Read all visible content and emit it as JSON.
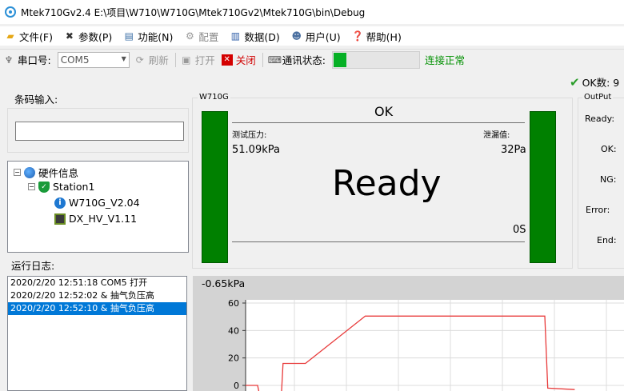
{
  "window": {
    "title": "Mtek710Gv2.4 E:\\项目\\W710\\W710G\\Mtek710Gv2\\Mtek710G\\bin\\Debug"
  },
  "menu": [
    {
      "label": "文件(F)",
      "icon": "folder-icon"
    },
    {
      "label": "参数(P)",
      "icon": "tools-icon"
    },
    {
      "label": "功能(N)",
      "icon": "document-icon"
    },
    {
      "label": "配置",
      "icon": "gear-icon"
    },
    {
      "label": "数据(D)",
      "icon": "chart-icon"
    },
    {
      "label": "用户(U)",
      "icon": "users-icon"
    },
    {
      "label": "帮助(H)",
      "icon": "help-icon"
    }
  ],
  "toolbar": {
    "port_label": "串口号:",
    "port_value": "COM5",
    "refresh_label": "刷新",
    "open_label": "打开",
    "close_label": "关闭",
    "comm_status_label": "通讯状态:",
    "comm_level": 0.15,
    "connection_text": "连接正常"
  },
  "ok_count_label": "OK数: 9",
  "barcode": {
    "label": "条码输入:",
    "value": ""
  },
  "tree": {
    "root": "硬件信息",
    "station": "Station1",
    "items": [
      "W710G_V2.04",
      "DX_HV_V1.11"
    ]
  },
  "w710g": {
    "group_title": "W710G",
    "result": "OK",
    "pressure_label": "测试压力:",
    "pressure_value": "51.09kPa",
    "leak_label": "泄漏值:",
    "leak_value": "32Pa",
    "status": "Ready",
    "time_value": "0S"
  },
  "output": {
    "group_title": "OutPut",
    "labels": [
      "Ready:",
      "OK:",
      "NG:",
      "Error:",
      "End:"
    ]
  },
  "log": {
    "label": "运行日志:",
    "entries": [
      "2020/2/20 12:51:18 COM5 打开",
      "2020/2/20 12:52:02 & 抽气负压高",
      "2020/2/20 12:52:10 & 抽气负压高"
    ],
    "selected_index": 2
  },
  "chart_data": {
    "type": "line",
    "title": "-0.65kPa",
    "yticks": [
      0,
      20,
      40,
      60
    ],
    "ylim": [
      -3,
      63
    ],
    "series": [
      {
        "color": "#e83a3a",
        "points": [
          [
            0,
            0
          ],
          [
            0.04,
            0
          ],
          [
            0.045,
            -5
          ],
          [
            0.12,
            -5
          ],
          [
            0.125,
            16
          ],
          [
            0.2,
            16
          ],
          [
            0.4,
            50.5
          ],
          [
            1.0,
            50.5
          ],
          [
            1.01,
            -2
          ],
          [
            1.1,
            -3
          ]
        ]
      }
    ]
  },
  "colors": {
    "status_green": "#008000",
    "selection": "#0078d7",
    "comm_fill": "#06b025",
    "trace": "#e83a3a"
  }
}
